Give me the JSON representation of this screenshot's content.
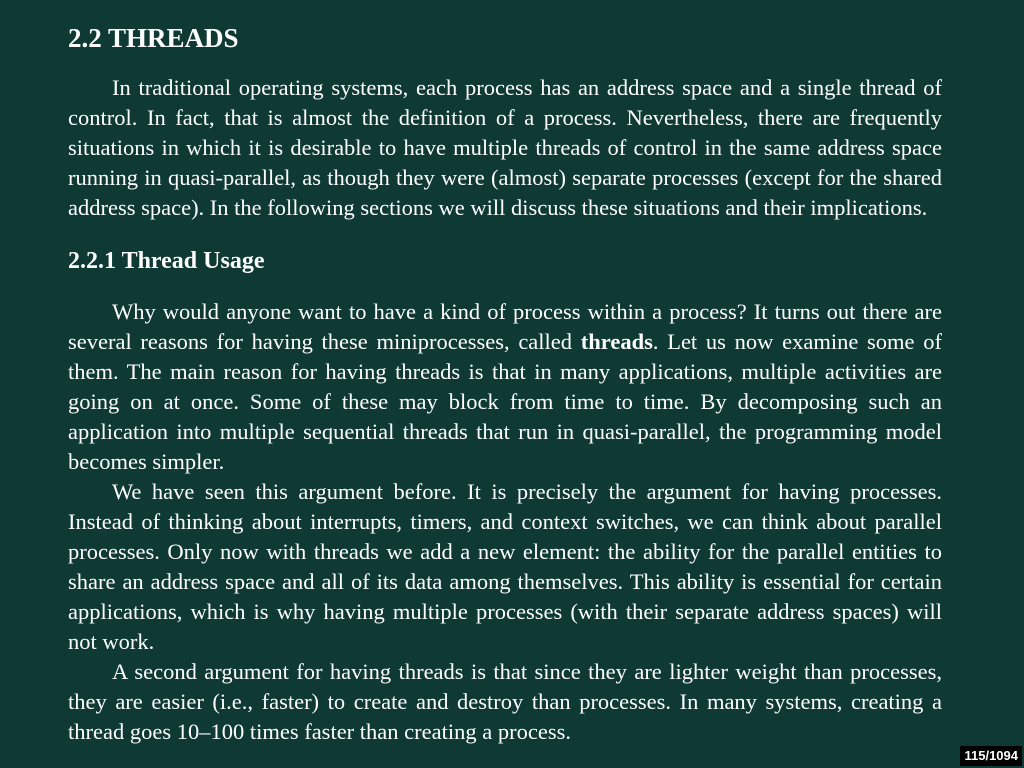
{
  "section": {
    "heading": "2.2  THREADS",
    "intro": "In traditional operating systems, each process has an address space and a single thread of control.  In fact, that is almost the definition of a process.  Nevertheless, there are frequently situations in which it is desirable to have multiple threads of control in the same address space running in quasi-parallel, as though they were (almost) separate processes (except for the shared address space).  In the following sections we will discuss these situations and their implications."
  },
  "subsection": {
    "heading": "2.2.1  Thread Usage",
    "p1_before": "Why would anyone want to have a kind of process within a process?  It turns out there are several reasons for having these miniprocesses, called ",
    "p1_bold": "threads",
    "p1_after": ".  Let us now examine some of them. The main reason for having threads is that in many applications, multiple activities are going on at once. Some of these may block from time to time.  By decomposing such an application into multiple sequential threads that run in quasi-parallel, the programming model becomes simpler.",
    "p2": "We have seen this argument before.  It is precisely the argument for having processes.  Instead of thinking about interrupts, timers, and context switches, we can think about parallel processes. Only now with threads we add a new element: the ability for the parallel entities to share an address space and all of its data among themselves. This ability is essential for certain applications, which is why having multiple processes (with their separate address spaces) will not work.",
    "p3": "A second argument for having threads is that since they are lighter weight than processes, they are easier (i.e., faster) to create and destroy than processes.  In many systems, creating a thread goes 10–100 times faster than creating a process."
  },
  "page_indicator": "115/1094"
}
